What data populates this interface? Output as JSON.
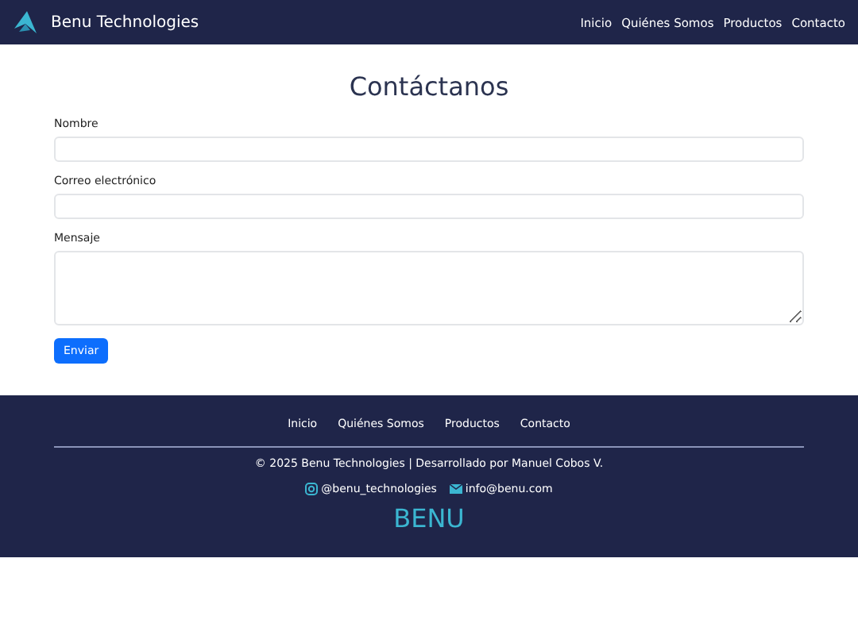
{
  "navbar": {
    "brand": "Benu Technologies",
    "links": [
      "Inicio",
      "Quiénes Somos",
      "Productos",
      "Contacto"
    ]
  },
  "form": {
    "title": "Contáctanos",
    "fields": [
      {
        "kind": "text",
        "label": "Nombre"
      },
      {
        "kind": "text",
        "label": "Correo electrónico"
      },
      {
        "kind": "textarea",
        "label": "Mensaje"
      }
    ],
    "submit": "Enviar"
  },
  "footer": {
    "links": [
      "Inicio",
      "Quiénes Somos",
      "Productos",
      "Contacto"
    ],
    "copyright": "© 2025 Benu Technologies | Desarrollado por Manuel Cobos V.",
    "socials": [
      {
        "kind": "instagram",
        "text": "@benu_technologies"
      },
      {
        "kind": "email",
        "text": "info@benu.com"
      }
    ],
    "logo": "BENU"
  }
}
